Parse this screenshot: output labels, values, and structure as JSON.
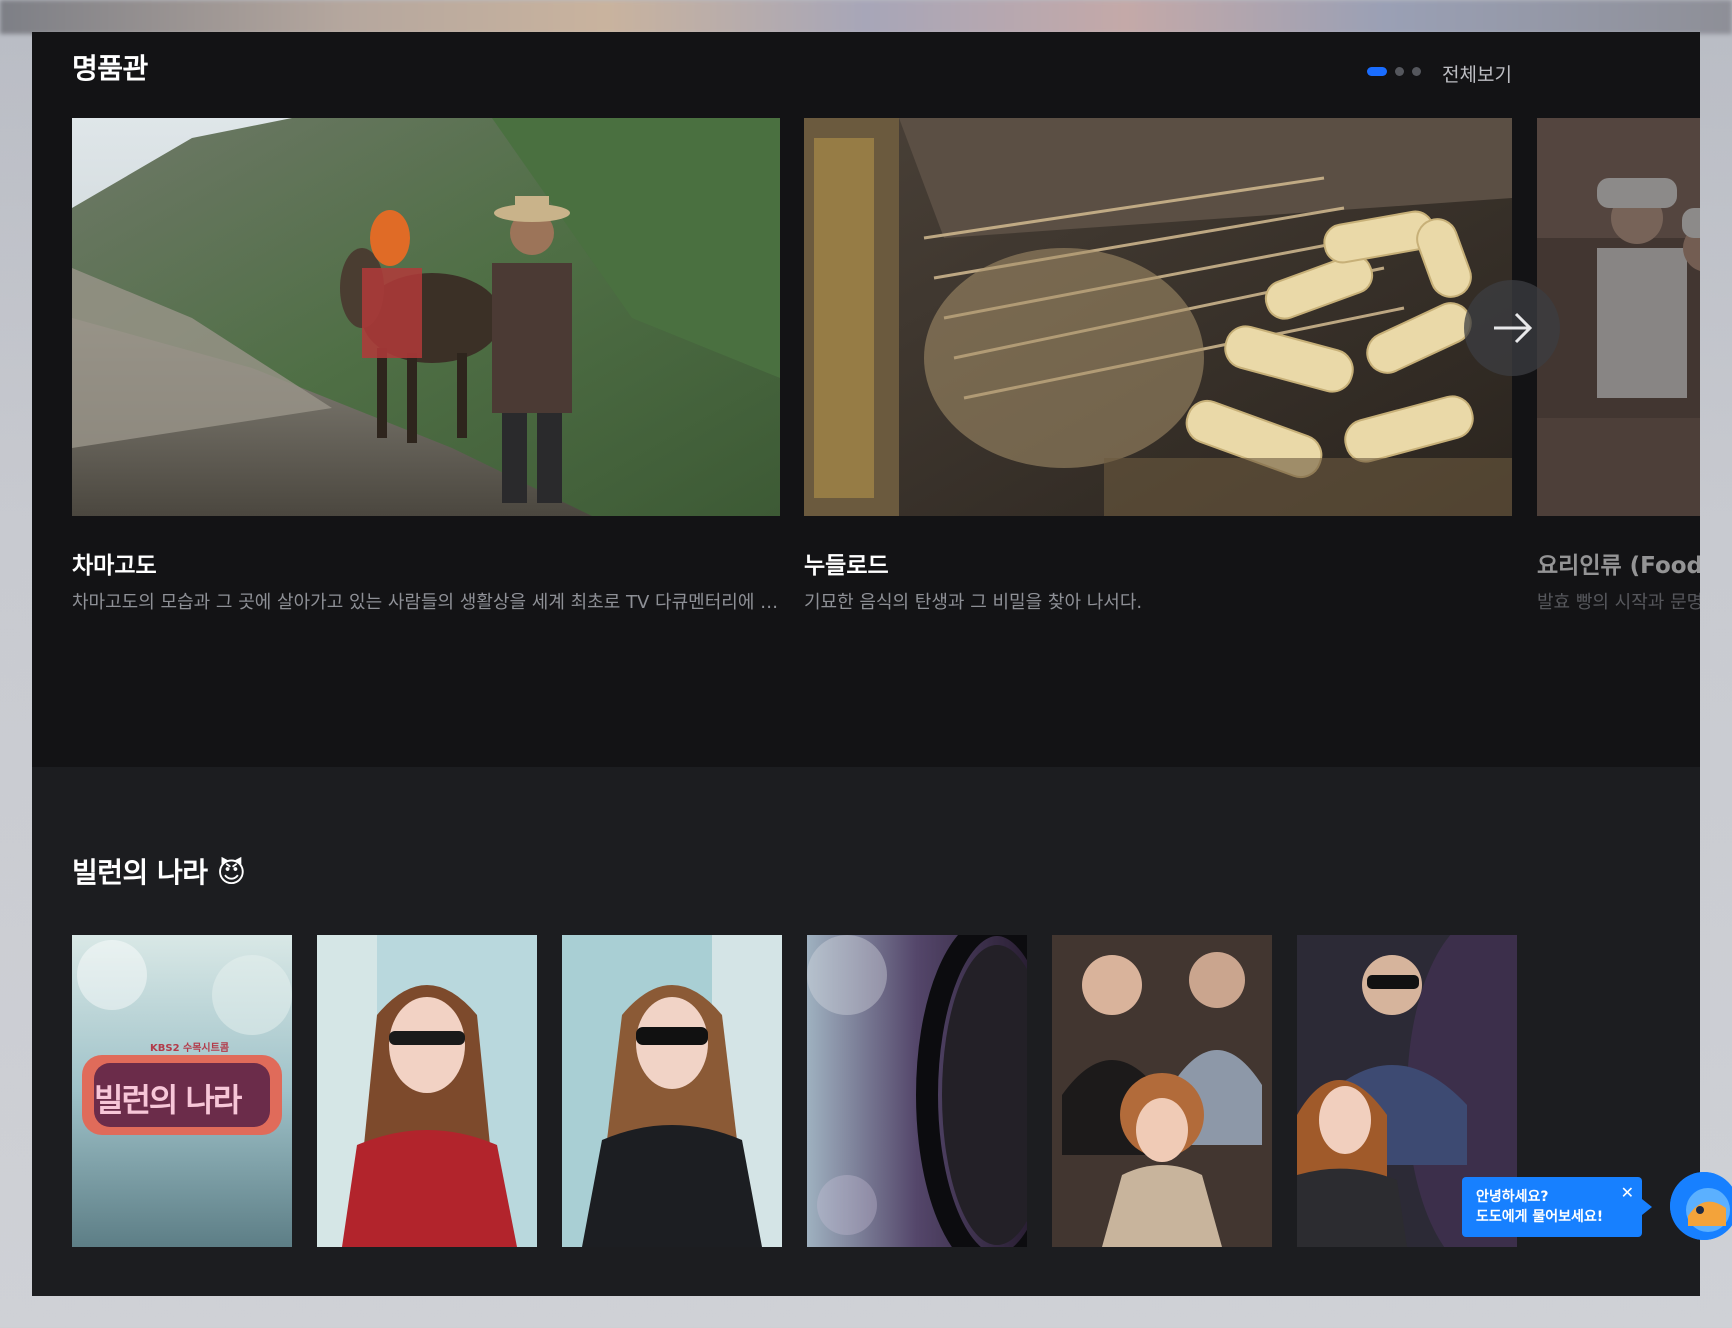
{
  "section1": {
    "title": "명품관",
    "see_all": "전체보기",
    "pager_dots": 3,
    "cards": [
      {
        "title": "차마고도",
        "desc": "차마고도의 모습과 그 곳에 살아가고 있는 사람들의 생활상을 세계 최초로 TV 다큐멘터리에 담은 작품"
      },
      {
        "title": "누들로드",
        "desc": "기묘한 음식의 탄생과 그 비밀을 찾아 나서다."
      },
      {
        "title": "요리인류 (Food Odyssey)",
        "desc": "발효 빵의 시작과 문명"
      }
    ]
  },
  "section2": {
    "title": "빌런의 나라 😈",
    "logo_text": "빌런의 나라",
    "logo_sub": "KBS2 수목시트콤"
  },
  "chat": {
    "line1": "안녕하세요?",
    "line2": "도도에게 물어보세요!",
    "close": "✕"
  }
}
